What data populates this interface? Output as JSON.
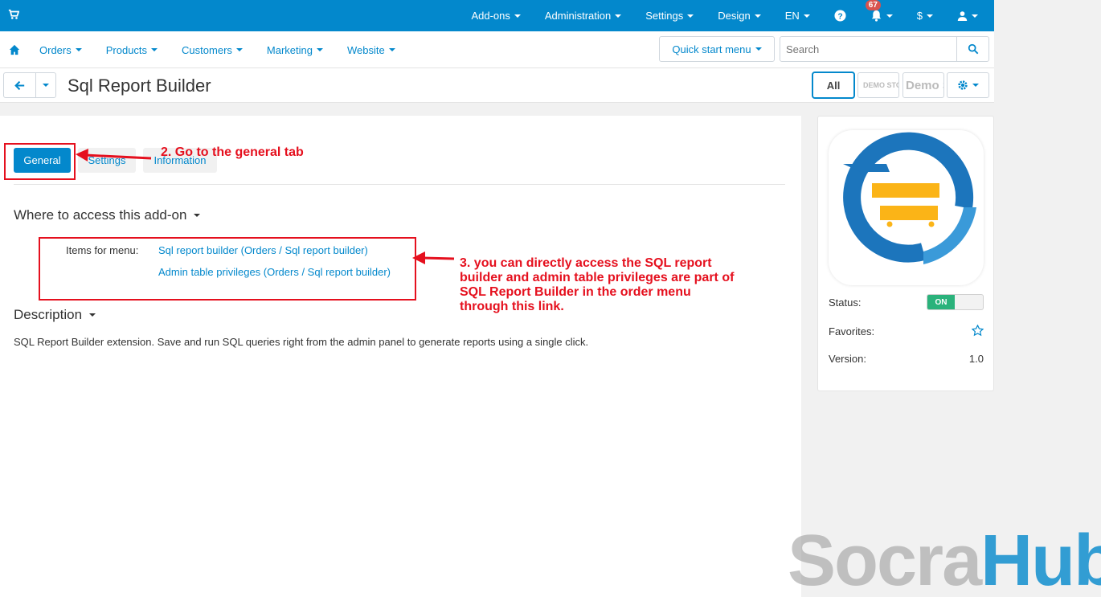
{
  "topbar": {
    "menu": [
      "Add-ons",
      "Administration",
      "Settings",
      "Design",
      "EN"
    ],
    "notifications_count": "67",
    "currency": "$"
  },
  "navbar": {
    "items": [
      "Orders",
      "Products",
      "Customers",
      "Marketing",
      "Website"
    ],
    "quick_start": "Quick start menu",
    "search_placeholder": "Search"
  },
  "titlebar": {
    "title": "Sql Report Builder",
    "all_label": "All",
    "store1": "DEMO STORE",
    "store2": "Demo Store"
  },
  "tabs": [
    "General",
    "Settings",
    "Information"
  ],
  "where_section": {
    "heading": "Where to access this add-on",
    "label": "Items for menu:",
    "links": [
      "Sql report builder (Orders / Sql report builder)",
      "Admin table privileges (Orders / Sql report builder)"
    ]
  },
  "description": {
    "heading": "Description",
    "text": "SQL Report Builder extension. Save and run SQL queries right from the admin panel to generate reports using a single click."
  },
  "sidebar": {
    "status_label": "Status:",
    "status_value": "ON",
    "favorites_label": "Favorites:",
    "version_label": "Version:",
    "version_value": "1.0"
  },
  "annotations": {
    "step2": "2. Go to the general tab",
    "step3": "3. you can directly access the SQL report builder and admin table privileges are part of SQL Report Builder in the order menu through this link."
  },
  "watermark": {
    "part1": "Socra",
    "part2": "Hub"
  },
  "colors": {
    "primary": "#0388cc",
    "annotation": "#e5101e",
    "toggle_on": "#2ab27b"
  }
}
